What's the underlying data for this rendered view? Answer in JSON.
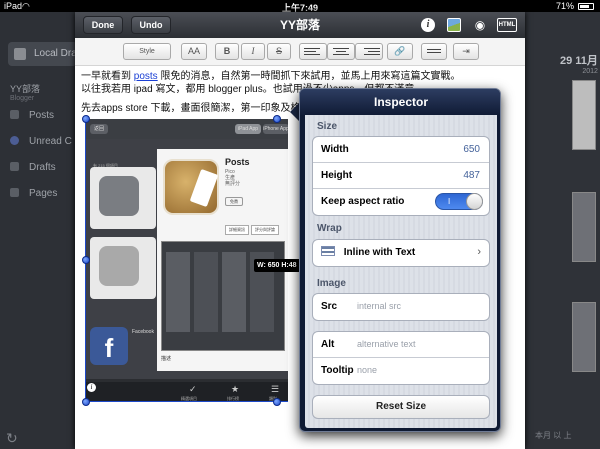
{
  "status": {
    "carrier": "iPad",
    "time": "上午7:49",
    "battery": "71%"
  },
  "background": {
    "local_drafts": "Local Dra",
    "blog_name": "YY部落",
    "blog_sub": "Blogger",
    "nav": [
      "Posts",
      "Unread C",
      "Drafts",
      "Pages"
    ],
    "date_day": "29 11月",
    "date_year": "2012",
    "bottom_right": "本月 以 上"
  },
  "header": {
    "done_label": "Done",
    "undo_label": "Undo",
    "title": "YY部落",
    "html_label": "HTML"
  },
  "toolbar": {
    "style_label": "Style",
    "font_size_label": "AA",
    "bold_label": "B",
    "italic_label": "I",
    "strike_label": "S",
    "link_label": "🔗",
    "indent_label": "⇥"
  },
  "content": {
    "para1_pre": "一早就看到",
    "para1_link": "posts",
    "para1_post": "限免的消息，自然第一時間抓下來試用，並馬上用來寫這篇文實戰。",
    "para2": "以往我若用 ipad 寫文，都用 blogger plus。也試用過不少apps，但都不滿意。",
    "para3": "先去apps store 下載，畫面很簡潔，第一印象及格。"
  },
  "embedded_image": {
    "back_label": "返回",
    "tab_ipad": "iPad App",
    "tab_iphone": "iPhone App",
    "page_label": "有 215 個項目",
    "app_name": "Posts",
    "app_sub_1": "Pico",
    "app_sub_2": "生產",
    "app_sub_3": "無評分",
    "buy_label": "免費",
    "seg_1": "詳細資訊",
    "seg_2": "評分與評論",
    "fb_letter": "f",
    "fb_label": "Facebook",
    "desc": "描述",
    "bottom_1": "精選項目",
    "bottom_2": "排行榜",
    "bottom_3": "類別"
  },
  "size_tooltip": "W: 650 H:48",
  "inspector": {
    "title": "Inspector",
    "size_section": "Size",
    "width_label": "Width",
    "width_value": "650",
    "height_label": "Height",
    "height_value": "487",
    "aspect_label": "Keep aspect ratio",
    "aspect_toggle": "I",
    "wrap_section": "Wrap",
    "wrap_value": "Inline with Text",
    "image_section": "Image",
    "src_label": "Src",
    "src_placeholder": "internal src",
    "alt_label": "Alt",
    "alt_placeholder": "alternative text",
    "tooltip_label": "Tooltip",
    "tooltip_placeholder": "none",
    "reset_label": "Reset Size"
  }
}
